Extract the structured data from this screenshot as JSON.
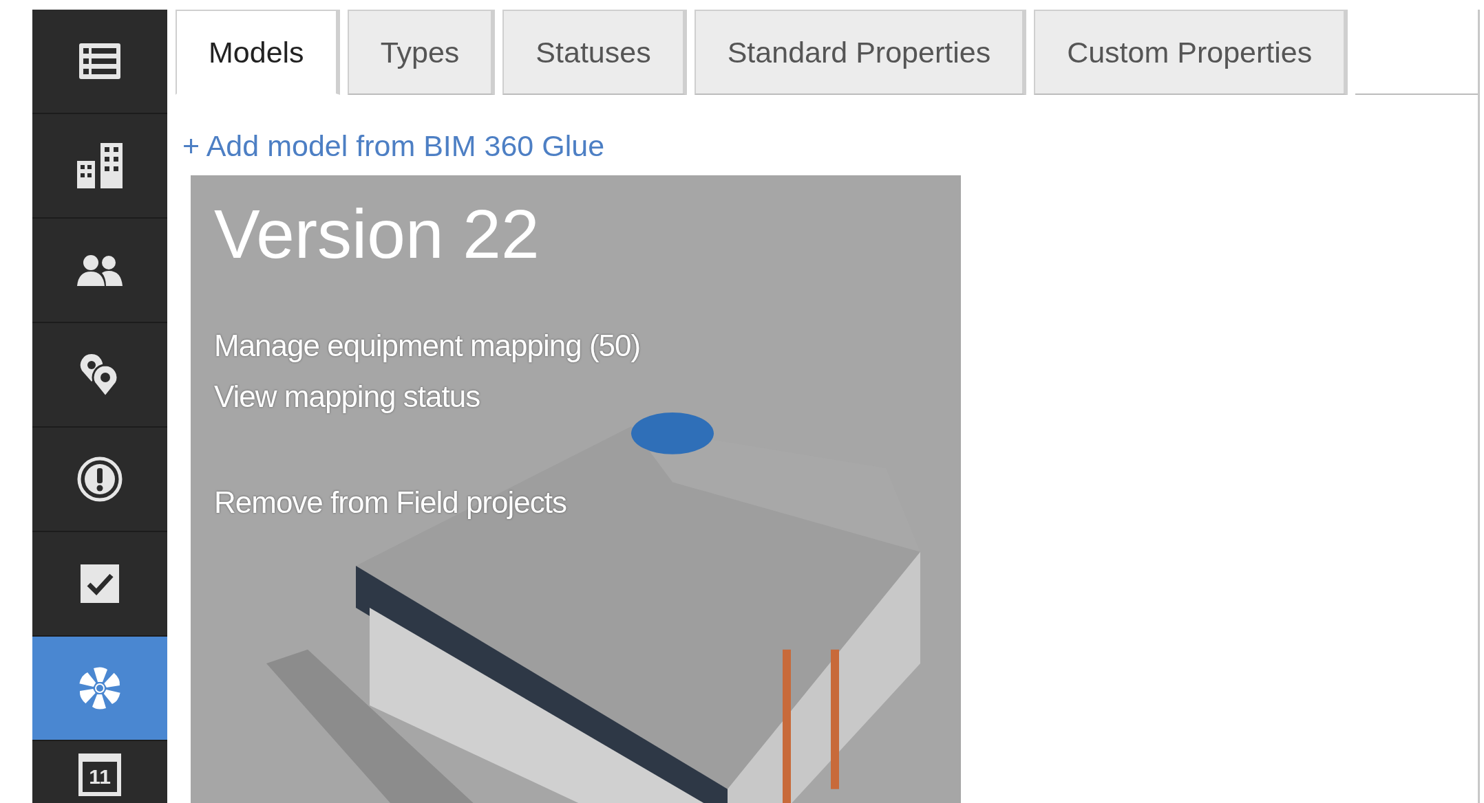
{
  "sidebar": {
    "items": [
      {
        "kind": "list",
        "selected": false
      },
      {
        "kind": "buildings",
        "selected": false
      },
      {
        "kind": "people",
        "selected": false
      },
      {
        "kind": "locations",
        "selected": false
      },
      {
        "kind": "issue",
        "selected": false
      },
      {
        "kind": "checklist",
        "selected": false
      },
      {
        "kind": "equipment",
        "selected": true
      },
      {
        "kind": "calendar",
        "selected": false,
        "icon_text": "11"
      }
    ]
  },
  "tabs": [
    {
      "label": "Models",
      "selected": true
    },
    {
      "label": "Types",
      "selected": false
    },
    {
      "label": "Statuses",
      "selected": false
    },
    {
      "label": "Standard Properties",
      "selected": false
    },
    {
      "label": "Custom Properties",
      "selected": false
    }
  ],
  "add_link": "+ Add model from BIM 360 Glue",
  "model_card": {
    "title": "Version 22",
    "actions": [
      {
        "label": "Manage equipment mapping (50)"
      },
      {
        "label": "View mapping status"
      }
    ],
    "secondary_actions": [
      {
        "label": "Remove from Field projects"
      }
    ]
  }
}
